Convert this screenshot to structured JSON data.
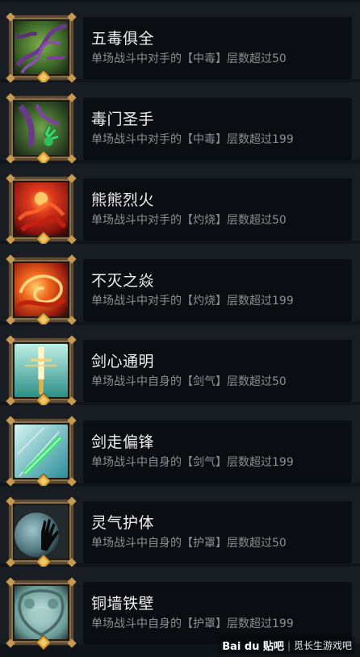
{
  "achievements": [
    {
      "title": "五毒俱全",
      "description": "单场战斗中对手的【中毒】层数超过50",
      "icon": "poison-vines-icon"
    },
    {
      "title": "毒门圣手",
      "description": "单场战斗中对手的【中毒】层数超过199",
      "icon": "poison-hand-icon"
    },
    {
      "title": "熊熊烈火",
      "description": "单场战斗中对手的【灼烧】层数超过50",
      "icon": "fire-orb-icon"
    },
    {
      "title": "不灭之焱",
      "description": "单场战斗中对手的【灼烧】层数超过199",
      "icon": "fire-swirl-icon"
    },
    {
      "title": "剑心通明",
      "description": "单场战斗中自身的【剑气】层数超过50",
      "icon": "glowing-sword-icon"
    },
    {
      "title": "剑走偏锋",
      "description": "单场战斗中自身的【剑气】层数超过199",
      "icon": "jade-sword-icon"
    },
    {
      "title": "灵气护体",
      "description": "单场战斗中自身的【护罩】层数超过50",
      "icon": "shield-hand-icon"
    },
    {
      "title": "铜墙铁壁",
      "description": "单场战斗中自身的【护罩】层数超过199",
      "icon": "stone-shield-icon"
    }
  ],
  "watermark": {
    "logo": "Bai du 贴吧",
    "separator": "|",
    "text": "觅长生游戏吧"
  }
}
